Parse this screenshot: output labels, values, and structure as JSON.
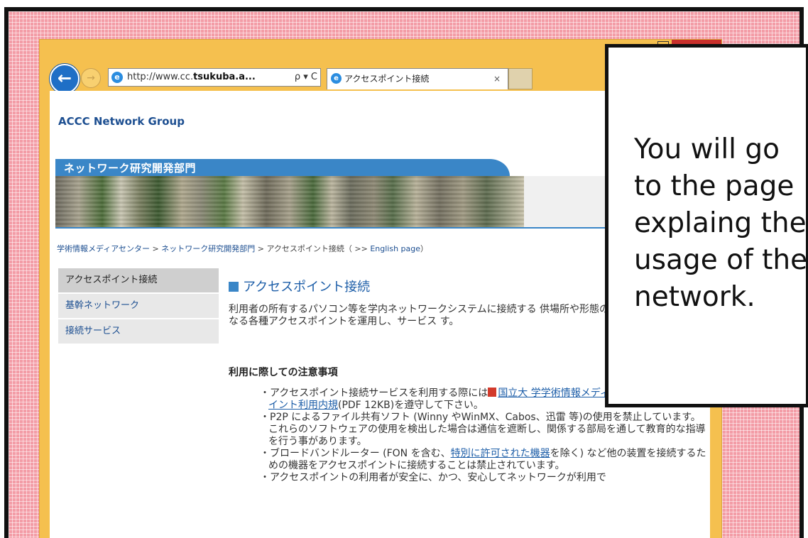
{
  "window": {
    "close_label": "×"
  },
  "toolbar": {
    "back_glyph": "←",
    "forward_glyph": "→",
    "address_prefix": "http://www.cc.",
    "address_host": "tsukuba.a...",
    "address_tools": "ρ ▾ C",
    "tab_title": "アクセスポイント接続",
    "tab_close": "×",
    "ie_glyph": "e"
  },
  "page": {
    "site_title": "ACCC Network Group",
    "banner_title": "ネットワーク研究開発部門",
    "breadcrumb": {
      "item1": "学術情報メディアセンター",
      "sep1": " > ",
      "item2": "ネットワーク研究開発部門",
      "sep2": " > ",
      "current": "アクセスポイント接続（",
      "english_prefix": " >> ",
      "english_link": "English page",
      "close": "）"
    },
    "sidenav": [
      {
        "label": "アクセスポイント接続"
      },
      {
        "label": "基幹ネットワーク"
      },
      {
        "label": "接続サービス"
      }
    ],
    "content_title": "アクセスポイント接続",
    "intro": "利用者の所有するパソコン等を学内ネットワークシステムに接続する 供場所や形態の異なる各種アクセスポイントを運用し、サービス す。",
    "notes_heading": "利用に際しての注意事項",
    "notes": {
      "n1_a": "アクセスポイント接続サービスを利用する際には",
      "n1_link": "国立大 学学術情報メディアセンターアクセスポイント利用内規",
      "n1_b": "(PDF 12KB)を遵守して下さい。",
      "n2": "P2P によるファイル共有ソフト (Winny やWinMX、Cabos、迅雷 等)の使用を禁止しています。 これらのソフトウェアの使用を検出した場合は通信を遮断し、関係する部局を通して教育的な指導を行う事があります。",
      "n3_a": "ブロードバンドルーター (FON を含む、",
      "n3_link": "特別に許可された機器",
      "n3_b": "を除く) など他の装置を接続するための機器をアクセスポイントに接続することは禁止されています。",
      "n4": "アクセスポイントの利用者が安全に、かつ、安心してネットワークが利用で"
    }
  },
  "callout": {
    "line1": "You will go",
    "line2": "to the page",
    "line3": "explaing the",
    "line4": "usage of the",
    "line5": "network."
  }
}
